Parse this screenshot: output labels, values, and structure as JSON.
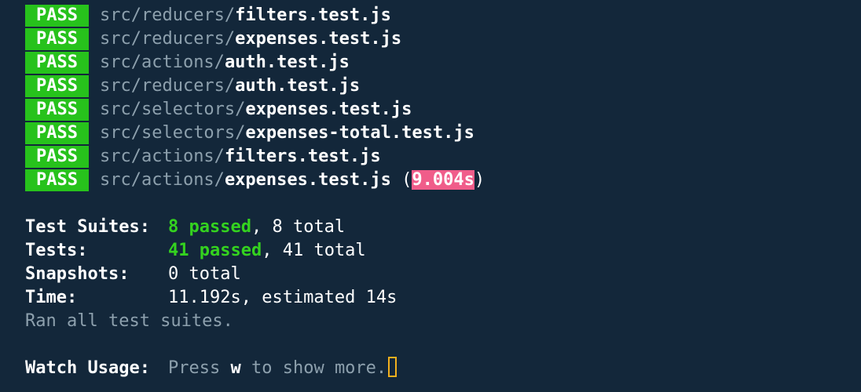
{
  "results": [
    {
      "status": "PASS",
      "dir": "src/reducers/",
      "file": "filters.test.js"
    },
    {
      "status": "PASS",
      "dir": "src/reducers/",
      "file": "expenses.test.js"
    },
    {
      "status": "PASS",
      "dir": "src/actions/",
      "file": "auth.test.js"
    },
    {
      "status": "PASS",
      "dir": "src/reducers/",
      "file": "auth.test.js"
    },
    {
      "status": "PASS",
      "dir": "src/selectors/",
      "file": "expenses.test.js"
    },
    {
      "status": "PASS",
      "dir": "src/selectors/",
      "file": "expenses-total.test.js"
    },
    {
      "status": "PASS",
      "dir": "src/actions/",
      "file": "filters.test.js"
    },
    {
      "status": "PASS",
      "dir": "src/actions/",
      "file": "expenses.test.js",
      "duration": "9.004s"
    }
  ],
  "summary": {
    "suites_label": "Test Suites:",
    "suites_passed": "8 passed",
    "suites_total": ", 8 total",
    "tests_label": "Tests:",
    "tests_passed": "41 passed",
    "tests_total": ", 41 total",
    "snapshots_label": "Snapshots:",
    "snapshots_value": "0 total",
    "time_label": "Time:",
    "time_value": "11.192s, estimated 14s",
    "ran_all": "Ran all test suites."
  },
  "watch": {
    "label": "Watch Usage:",
    "press": "Press ",
    "key": "w",
    "rest": " to show more."
  },
  "colors": {
    "background": "#13273a",
    "pass_badge": "#27c21c",
    "passed_text": "#34d21f",
    "slow_highlight": "#f05d8a",
    "muted_text": "#8da0ad",
    "cursor": "#f2b01e"
  }
}
